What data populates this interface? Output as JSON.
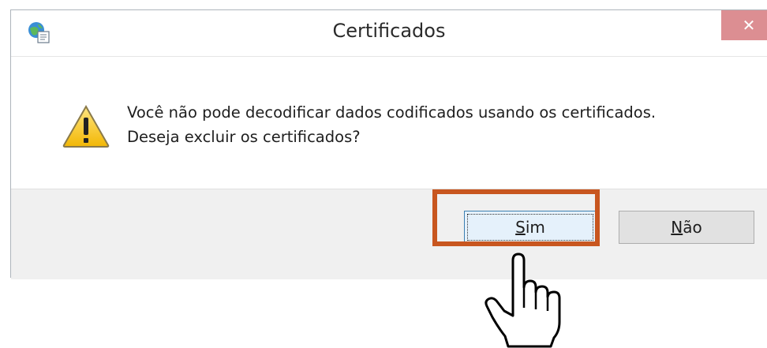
{
  "dialog": {
    "title": "Certificados",
    "close_label": "✕",
    "message_line1": "Você não pode decodificar dados codificados usando os certificados.",
    "message_line2": "Deseja excluir os certificados?",
    "buttons": {
      "yes": {
        "accel": "S",
        "rest": "im"
      },
      "no": {
        "accel": "N",
        "rest": "ão"
      }
    },
    "icons": {
      "app": "globe-certificate-icon",
      "warning": "warning-icon",
      "pointer": "hand-pointer-icon"
    },
    "colors": {
      "highlight": "#c8561f",
      "close": "#dc8e92",
      "footer": "#f0f0f0"
    }
  }
}
